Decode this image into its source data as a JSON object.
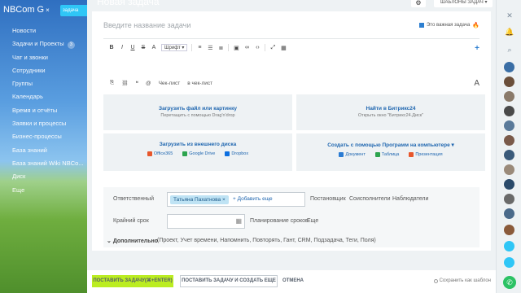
{
  "app": {
    "brand": "NBCom G",
    "brand_close": "×",
    "flag": "задача"
  },
  "sidebar": {
    "items": [
      {
        "label": "Новости"
      },
      {
        "label": "Задачи и Проекты",
        "badge": "3"
      },
      {
        "label": "Чат и звонки"
      },
      {
        "label": "Сотрудники"
      },
      {
        "label": "Группы"
      },
      {
        "label": "Календарь"
      },
      {
        "label": "Время и отчёты"
      },
      {
        "label": "Заявки и процессы"
      },
      {
        "label": "Бизнес-процессы"
      },
      {
        "label": "База знаний"
      },
      {
        "label": "База знаний Wiki NBCo..."
      },
      {
        "label": "Диск"
      },
      {
        "label": "Еще"
      }
    ]
  },
  "header": {
    "title": "Новая задача",
    "templates_label": "ШАБЛОНЫ ЗАДАЧ"
  },
  "form": {
    "task_name_placeholder": "Введите название задачи",
    "important_label": "Это важная задача",
    "toolbar": {
      "font_label": "Шрифт"
    },
    "bottom_tools": {
      "checklist": "Чек-лист",
      "in_checklist": "в чек-лист",
      "font_size": "A"
    },
    "upload": {
      "title": "Загрузить файл или картинку",
      "subtitle": "Перетащить с помощью Drag'n'drop"
    },
    "bitrix": {
      "title": "Найти в Битрикс24",
      "subtitle": "Открыть окно \"Битрикс24.Диск\""
    },
    "external": {
      "title": "Загрузить из внешнего диска",
      "services": [
        "Office365",
        "Google Drive",
        "Dropbox"
      ]
    },
    "create": {
      "title": "Создать с помощью Программ на компьютере",
      "services": [
        "Документ",
        "Таблица",
        "Презентация"
      ]
    },
    "responsible": {
      "label": "Ответственный",
      "chip": "Татьяна Пахатнова",
      "add_more": "+ Добавить еще",
      "links": [
        "Постановщик",
        "Соисполнители",
        "Наблюдатели"
      ]
    },
    "deadline": {
      "label": "Крайний срок",
      "planning": "Планирование сроков",
      "more": "Еще"
    },
    "additional": {
      "label": "Дополнительно",
      "items": "(Проект,  Учет времени,  Напомнить,  Повторять,  Гант,  CRM,  Подзадача,  Теги,  Поля)"
    }
  },
  "footer": {
    "create_button": "ПОСТАВИТЬ ЗАДАЧУ(⌘+ENTER)",
    "create_and_new_button": "ПОСТАВИТЬ ЗАДАЧУ И СОЗДАТЬ ЕЩЕ",
    "cancel_button": "ОТМЕНА",
    "save_template": "Сохранить как шаблон"
  },
  "colors": {
    "accent": "#2067b0",
    "primary_button": "#bbed21",
    "chip": "#bfe3f4",
    "call": "#2cc264"
  }
}
